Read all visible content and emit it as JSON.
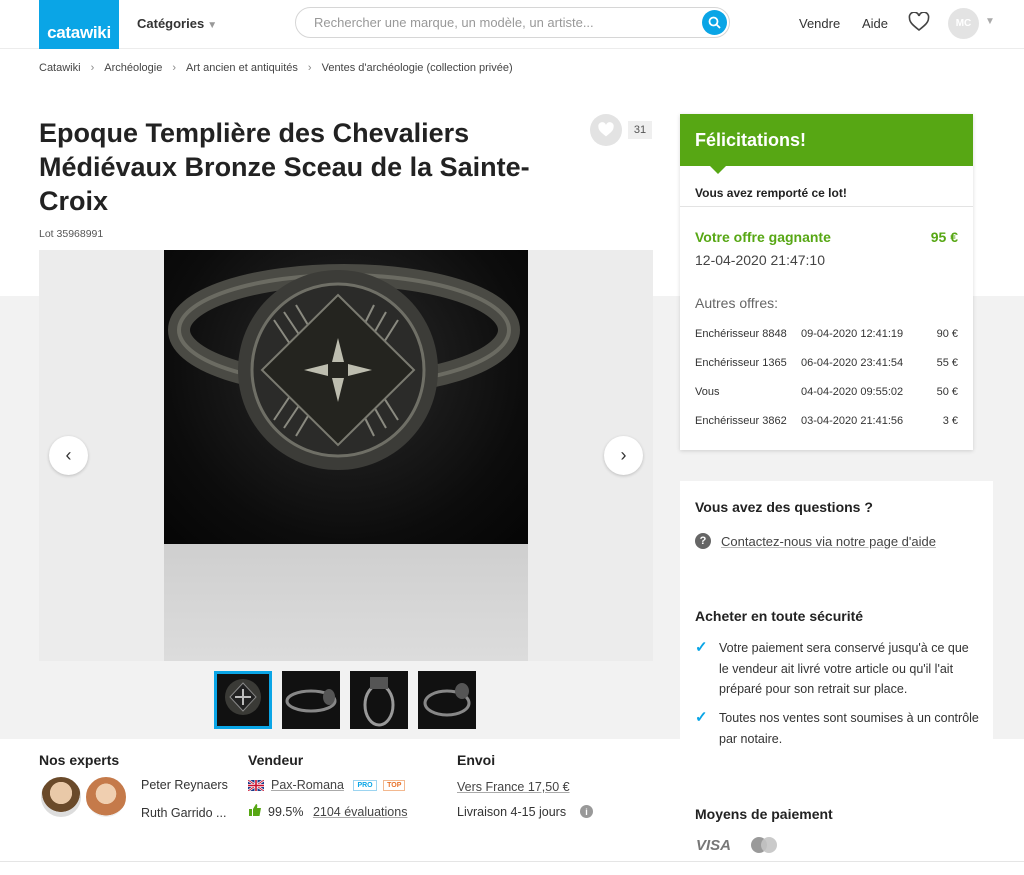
{
  "header": {
    "logo": "catawiki",
    "categories_label": "Catégories",
    "search_placeholder": "Rechercher une marque, un modèle, un artiste...",
    "sell_label": "Vendre",
    "help_label": "Aide",
    "user_initials": "MC"
  },
  "breadcrumb": [
    "Catawiki",
    "Archéologie",
    "Art ancien et antiquités",
    "Ventes d'archéologie (collection privée)"
  ],
  "lot": {
    "title": "Epoque Templière des Chevaliers Médiévaux Bronze Sceau de la Sainte-Croix",
    "lot_number": "Lot 35968991",
    "favorites_count": "31"
  },
  "winner": {
    "heading": "Félicitations!",
    "won_text": "Vous avez remporté ce lot!",
    "offer_label": "Votre offre gagnante",
    "offer_amount": "95 €",
    "offer_date": "12-04-2020 21:47:10",
    "other_offers_label": "Autres offres:",
    "other_offers": [
      {
        "bidder": "Enchérisseur 8848",
        "date": "09-04-2020 12:41:19",
        "amount": "90 €"
      },
      {
        "bidder": "Enchérisseur 1365",
        "date": "06-04-2020 23:41:54",
        "amount": "55 €"
      },
      {
        "bidder": "Vous",
        "date": "04-04-2020 09:55:02",
        "amount": "50 €"
      },
      {
        "bidder": "Enchérisseur 3862",
        "date": "03-04-2020 21:41:56",
        "amount": "3 €"
      }
    ]
  },
  "help": {
    "title": "Vous avez des questions ?",
    "link": "Contactez-nous via notre page d'aide",
    "safe_title": "Acheter en toute sécurité",
    "safe_point_1": "Votre paiement sera conservé jusqu'à ce que le vendeur ait livré votre article ou qu'il l'ait préparé pour son retrait sur place.",
    "safe_point_2": "Toutes nos ventes sont soumises à un contrôle par notaire."
  },
  "experts": {
    "heading": "Nos experts",
    "names": [
      "Peter Reynaers",
      "Ruth Garrido ..."
    ]
  },
  "seller": {
    "heading": "Vendeur",
    "name": "Pax-Romana",
    "badge_pro": "PRO",
    "badge_top": "TOP",
    "rating": "99.5%",
    "reviews": "2104 évaluations"
  },
  "shipping": {
    "heading": "Envoi",
    "cost": "Vers France 17,50 €",
    "delivery": "Livraison 4-15 jours"
  },
  "payment": {
    "heading": "Moyens de paiement",
    "visa": "VISA"
  },
  "colors": {
    "brand": "#0aa5e6",
    "success": "#57a714"
  }
}
